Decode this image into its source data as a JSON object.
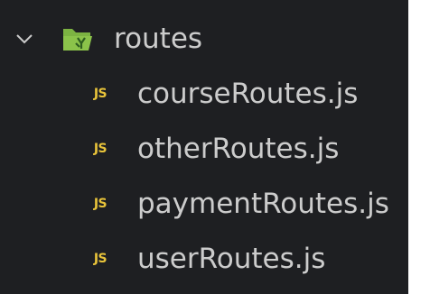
{
  "explorer": {
    "folder": {
      "label": "routes",
      "expanded": true,
      "icon": "folder-open-icon",
      "chevron": "chevron-down-icon"
    },
    "files": [
      {
        "label": "courseRoutes.js",
        "icon": "js-icon",
        "badge": "JS"
      },
      {
        "label": "otherRoutes.js",
        "icon": "js-icon",
        "badge": "JS"
      },
      {
        "label": "paymentRoutes.js",
        "icon": "js-icon",
        "badge": "JS"
      },
      {
        "label": "userRoutes.js",
        "icon": "js-icon",
        "badge": "JS"
      }
    ]
  },
  "colors": {
    "background": "#1e1f22",
    "text": "#cccccc",
    "js_badge": "#e8c33a",
    "folder_icon": "#8bc34a"
  }
}
